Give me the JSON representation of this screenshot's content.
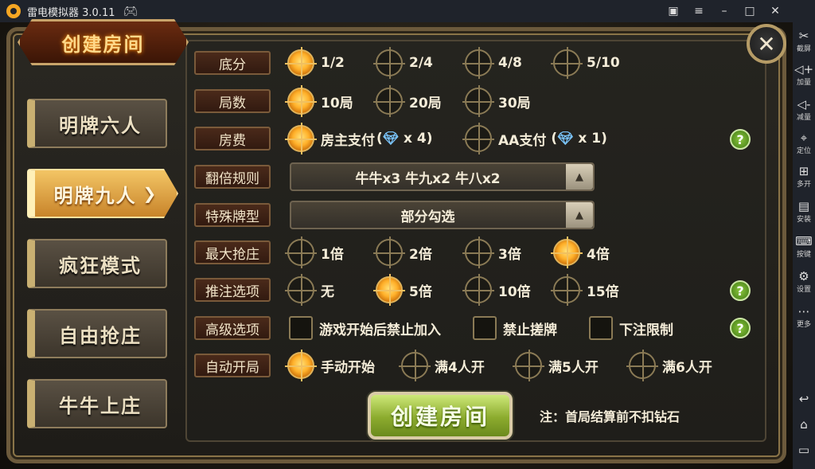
{
  "window": {
    "title": "雷电模拟器 3.0.11",
    "icons": [
      "logo-icon",
      "gamepad-icon",
      "gift-icon",
      "menu-icon",
      "minimize-icon",
      "maximize-icon",
      "close-icon"
    ]
  },
  "toolbar": {
    "items": [
      {
        "label": "截屏",
        "icon": "scissors-icon"
      },
      {
        "label": "加量",
        "icon": "volume-up-icon"
      },
      {
        "label": "减量",
        "icon": "volume-down-icon"
      },
      {
        "label": "定位",
        "icon": "location-icon"
      },
      {
        "label": "多开",
        "icon": "multi-open-icon"
      },
      {
        "label": "安装",
        "icon": "apk-install-icon"
      },
      {
        "label": "按键",
        "icon": "keyboard-icon"
      },
      {
        "label": "设置",
        "icon": "settings-icon"
      },
      {
        "label": "更多",
        "icon": "more-icon"
      }
    ],
    "nav_icons": [
      "back-icon",
      "home-icon",
      "recent-apps-icon"
    ]
  },
  "game": {
    "header": "创建房间",
    "modes": [
      {
        "label": "明牌六人",
        "active": false
      },
      {
        "label": "明牌九人",
        "active": true
      },
      {
        "label": "疯狂模式",
        "active": false
      },
      {
        "label": "自由抢庄",
        "active": false
      },
      {
        "label": "牛牛上庄",
        "active": false
      }
    ],
    "rows": {
      "base_score": {
        "label": "底分",
        "options": [
          "1/2",
          "2/4",
          "4/8",
          "5/10"
        ],
        "selected": 0
      },
      "rounds": {
        "label": "局数",
        "options": [
          "10局",
          "20局",
          "30局"
        ],
        "selected": 0
      },
      "room_fee": {
        "label": "房费",
        "options": [
          "房主支付",
          "AA支付"
        ],
        "amounts": [
          "x 4",
          "x 1"
        ],
        "selected": 0
      },
      "double_rule": {
        "label": "翻倍规则",
        "value": "牛牛x3  牛九x2  牛八x2"
      },
      "special_hand": {
        "label": "特殊牌型",
        "value": "部分勾选"
      },
      "max_banker": {
        "label": "最大抢庄",
        "options": [
          "1倍",
          "2倍",
          "3倍",
          "4倍"
        ],
        "selected": 3
      },
      "push_bet": {
        "label": "推注选项",
        "options": [
          "无",
          "5倍",
          "10倍",
          "15倍"
        ],
        "selected": 1
      },
      "advanced": {
        "label": "高级选项",
        "options": [
          "游戏开始后禁止加入",
          "禁止搓牌",
          "下注限制"
        ],
        "checked": [
          false,
          false,
          false
        ]
      },
      "auto_start": {
        "label": "自动开局",
        "options": [
          "手动开始",
          "满4人开",
          "满5人开",
          "满6人开"
        ],
        "selected": 0
      }
    },
    "create_button": "创建房间",
    "note": "注：首局结算前不扣钻石",
    "help_glyph": "?",
    "close_glyph": "✕"
  },
  "colors": {
    "accent_gold": "#ffb02a",
    "button_green": "#8cab2e",
    "label_bg": "#4a2a1a"
  }
}
